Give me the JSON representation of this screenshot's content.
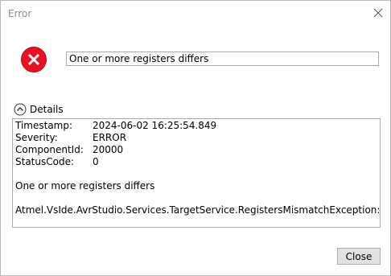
{
  "window": {
    "title": "Error"
  },
  "message": "One or more registers differs",
  "details": {
    "toggle_label": "Details",
    "fields": [
      {
        "key": "Timestamp:",
        "value": "2024-06-02 16:25:54.849"
      },
      {
        "key": "Severity:",
        "value": "ERROR"
      },
      {
        "key": "ComponentId:",
        "value": "20000"
      },
      {
        "key": "StatusCode:",
        "value": "0"
      }
    ],
    "description": "One or more registers differs",
    "exception": "Atmel.VsIde.AvrStudio.Services.TargetService.RegistersMismatchException:"
  },
  "buttons": {
    "close_label": "Close"
  },
  "icons": {
    "window_close": "close-icon",
    "message_icon": "error-icon",
    "details_toggle": "chevron-up-icon"
  },
  "colors": {
    "error_red": "#e81123",
    "title_gray": "#8c8c8c"
  }
}
